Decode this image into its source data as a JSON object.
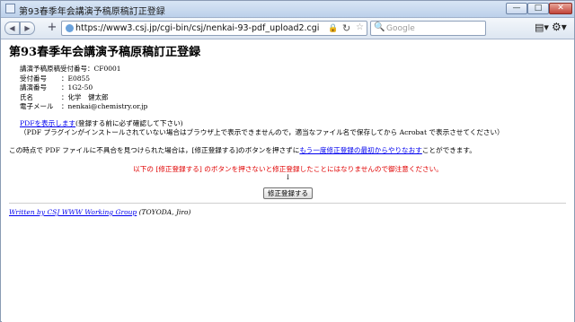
{
  "window": {
    "title": "第93春季年会講演予稿原稿訂正登録",
    "controls": {
      "minimize": "—",
      "maximize": "□",
      "close": "✕"
    }
  },
  "toolbar": {
    "back_icon": "◀",
    "forward_icon": "▶",
    "new_tab_icon": "+",
    "url": "https://www3.csj.jp/cgi-bin/csj/nenkai-93-pdf_upload2.cgi",
    "lock_icon": "🔒",
    "reload_icon": "↻",
    "star_icon": "☆",
    "search_icon": "🔍",
    "search_placeholder": "Google",
    "page_icon": "▤▾",
    "gear_icon": "⚙▾"
  },
  "page": {
    "heading": "第93春季年会講演予稿原稿訂正登録",
    "info": [
      {
        "label": "講演予稿原稿受付番号：",
        "value": "CF0001"
      },
      {
        "label": "受付番号",
        "value": "：E0855"
      },
      {
        "label": "講演番号",
        "value": "：1G2-50"
      },
      {
        "label": "氏名",
        "value": "：化学　健太郎"
      },
      {
        "label": "電子メール",
        "value": "：nenkai@chemistry.or.jp"
      }
    ],
    "pdf_link": "PDFを表示します",
    "pdf_after": "(登録する前に必ず確認して下さい)",
    "pdf_note": "（PDF プラグインがインストールされていない場合はブラウザ上で表示できませんので，適当なファイル名で保存してから Acrobat で表示させてください）",
    "notice_before": "この時点で PDF ファイルに不具合を見つけられた場合は，[修正登録する]のボタンを押さずに",
    "notice_link": "もう一度修正登録の最初からやりなおす",
    "notice_after": "ことができます。",
    "warning": "以下の [修正登録する] のボタンを押さないと修正登録したことにはなりませんので御注意ください。",
    "arrow": "↓",
    "submit_label": "修正登録する",
    "footer_link": "Written by CSJ WWW Working Group",
    "footer_author": " (TOYODA, Jiro)"
  },
  "colors": {
    "warning": "#e00000",
    "link": "#0000ee"
  }
}
